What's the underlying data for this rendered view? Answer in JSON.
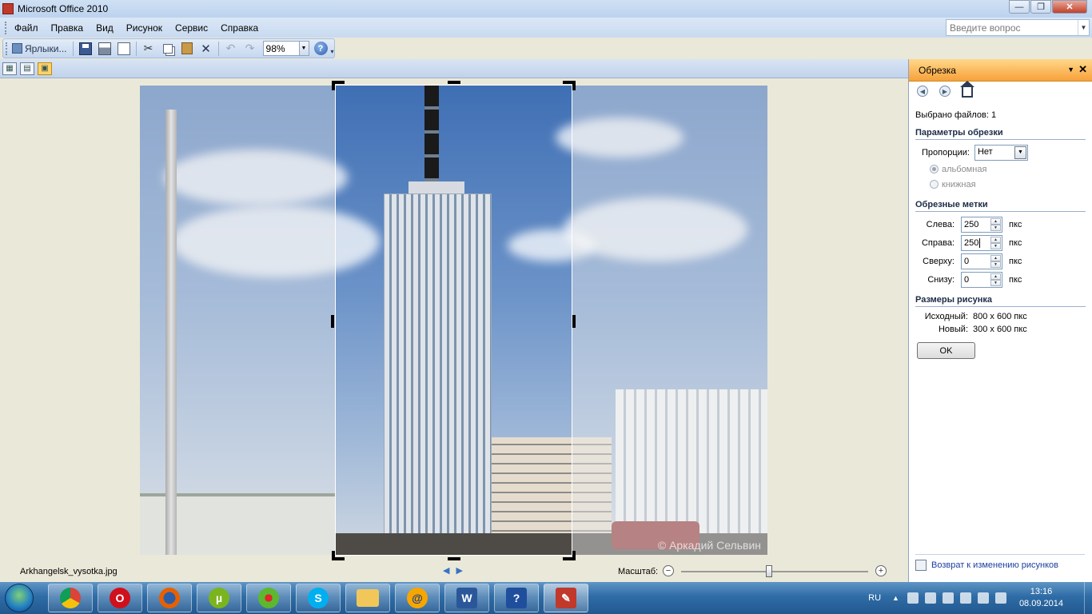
{
  "window": {
    "title": "Microsoft Office 2010"
  },
  "menu": {
    "items": [
      "Файл",
      "Правка",
      "Вид",
      "Рисунок",
      "Сервис",
      "Справка"
    ],
    "ask_placeholder": "Введите вопрос"
  },
  "toolbar": {
    "shortcuts_label": "Ярлыки...",
    "zoom_value": "98%"
  },
  "view_modes": [
    "thumbnails-view-icon",
    "filmstrip-view-icon",
    "single-picture-view-icon"
  ],
  "status": {
    "file_name": "Arkhangelsk_vysotka.jpg",
    "scale_label": "Масштаб:",
    "zoom_slider_fraction": 0.47
  },
  "image": {
    "watermark": "© Аркадий Сельвин"
  },
  "pane": {
    "title": "Обрезка",
    "selected_files": "Выбрано файлов: 1",
    "crop_params_title": "Параметры обрезки",
    "proportions_label": "Пропорции:",
    "proportions_value": "Нет",
    "landscape_label": "альбомная",
    "portrait_label": "книжная",
    "crop_marks_title": "Обрезные метки",
    "left_label": "Слева:",
    "left_value": "250",
    "right_label": "Справа:",
    "right_value": "250",
    "top_label": "Сверху:",
    "top_value": "0",
    "bottom_label": "Снизу:",
    "bottom_value": "0",
    "unit": "пкс",
    "sizes_title": "Размеры рисунка",
    "original_label": "Исходный:",
    "original_value": "800 x 600 пкс",
    "new_label": "Новый:",
    "new_value": "300 x 600 пкс",
    "ok_label": "OK",
    "back_link": "Возврат к изменению рисунков"
  },
  "taskbar": {
    "apps": [
      "chrome",
      "opera",
      "firefox",
      "utorrent",
      "icq",
      "skype",
      "explorer",
      "mail-agent",
      "word",
      "help",
      "picture-manager"
    ],
    "lang": "RU",
    "time": "13:16",
    "date": "08.09.2014"
  }
}
